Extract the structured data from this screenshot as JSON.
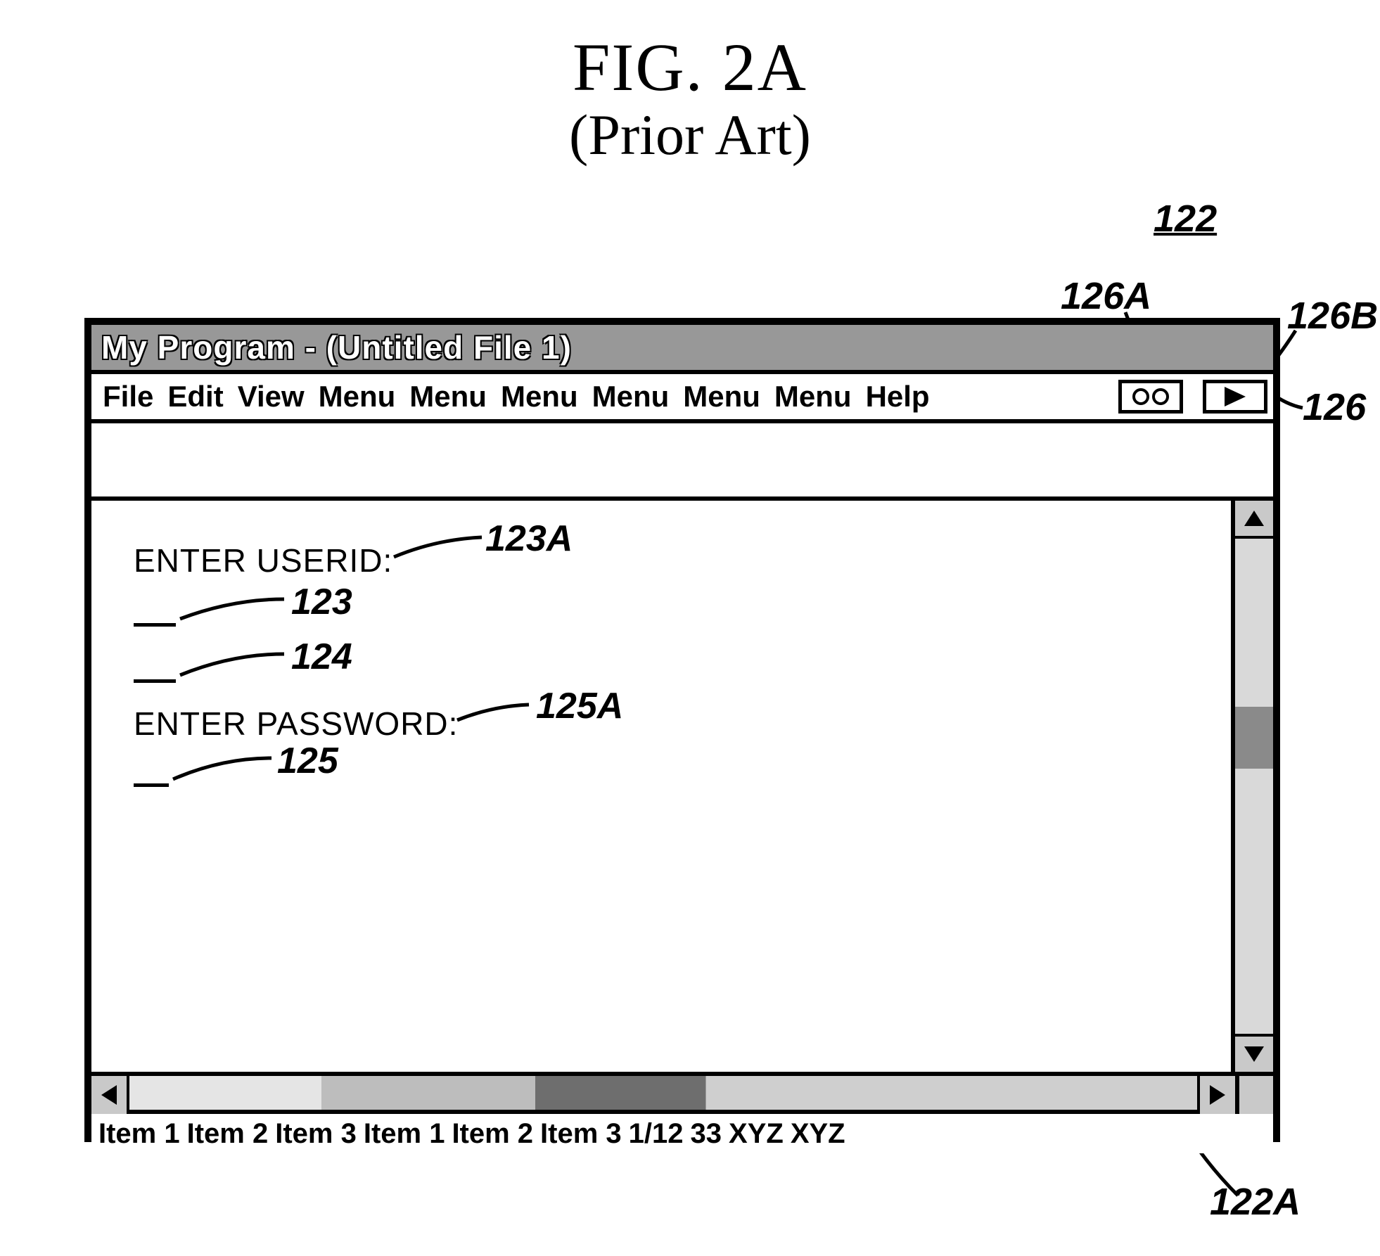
{
  "figure": {
    "title_main": "FIG. 2A",
    "title_sub": "(Prior Art)"
  },
  "callouts": {
    "c122": "122",
    "c126A": "126A",
    "c126B": "126B",
    "c126": "126",
    "c123A": "123A",
    "c123": "123",
    "c124": "124",
    "c125A": "125A",
    "c125": "125",
    "c122A": "122A"
  },
  "window": {
    "title": "My Program - (Untitled File 1)"
  },
  "menubar": {
    "items": [
      "File",
      "Edit",
      "View",
      "Menu",
      "Menu",
      "Menu",
      "Menu",
      "Menu",
      "Menu",
      "Help"
    ]
  },
  "form": {
    "userid_label": "ENTER USERID:",
    "password_label": "ENTER PASSWORD:"
  },
  "statusbar": {
    "items": [
      "Item 1",
      "Item 2",
      "Item 3",
      "Item 1",
      "Item 2",
      "Item 3",
      "1/12",
      "33",
      "XYZ",
      "XYZ"
    ]
  }
}
